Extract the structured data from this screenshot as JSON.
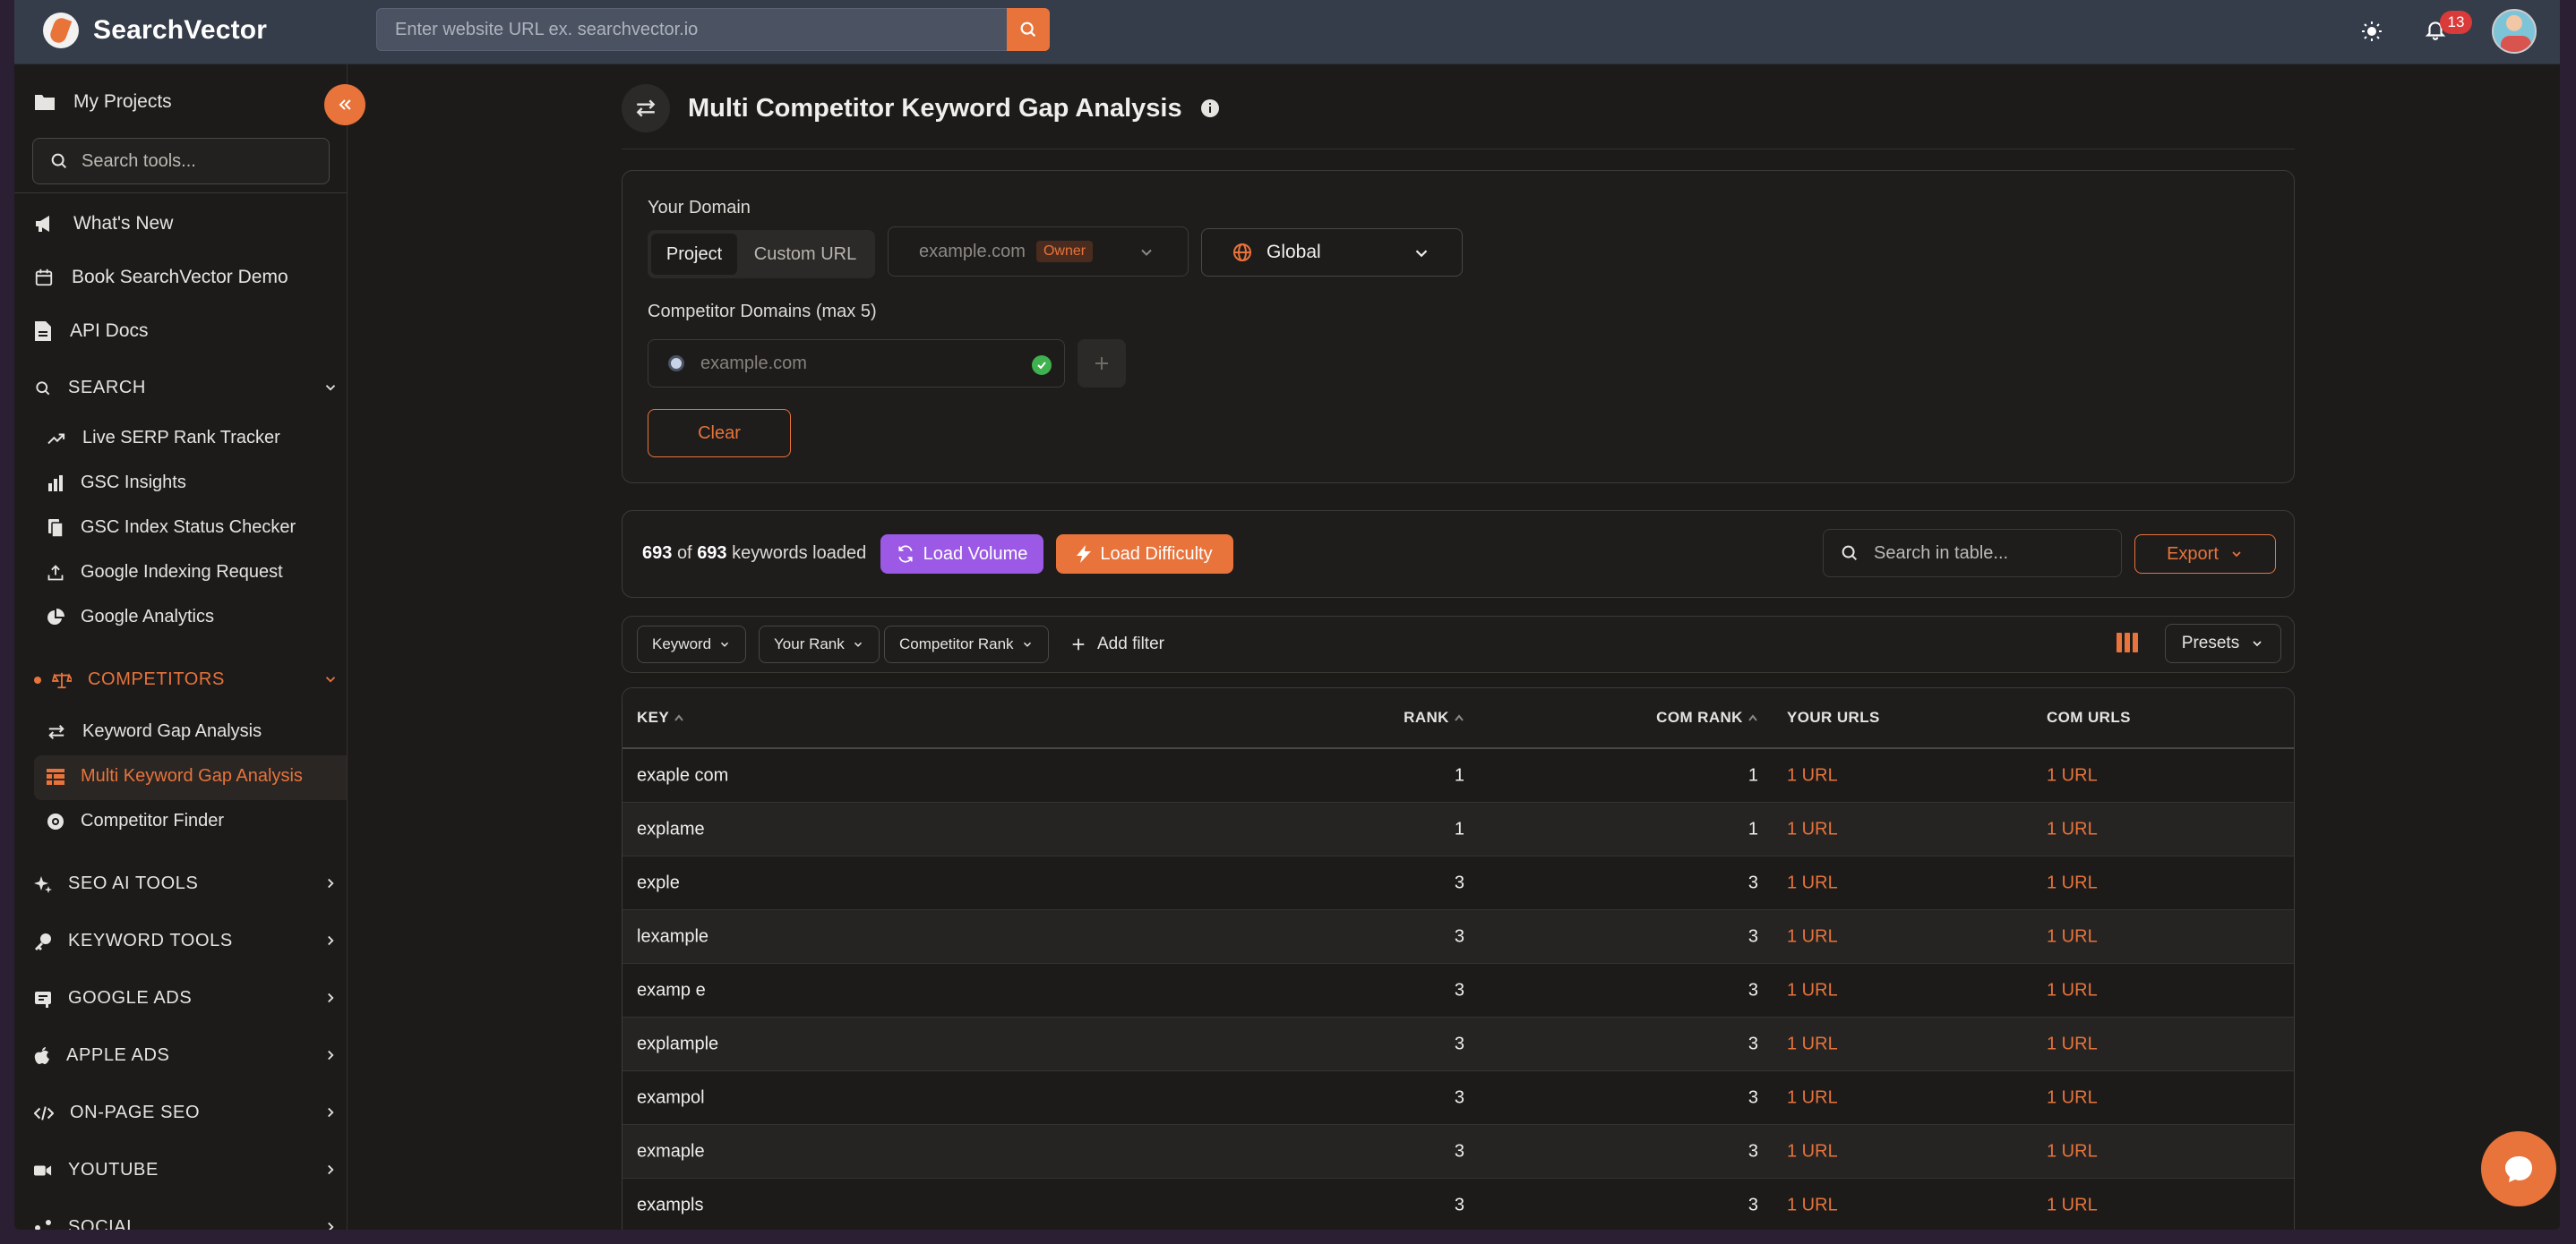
{
  "app": {
    "name": "SearchVector",
    "url_placeholder": "Enter website URL ex. searchvector.io",
    "notifications_count": "13",
    "colors": {
      "accent": "#e8733b",
      "purple": "#9b59e6",
      "topbar": "#353c4a",
      "background": "#1c1b1a"
    }
  },
  "sidebar": {
    "my_projects": "My Projects",
    "search_placeholder": "Search tools...",
    "links": [
      {
        "label": "What's New",
        "icon": "megaphone-icon"
      },
      {
        "label": "Book SearchVector Demo",
        "icon": "calendar-icon"
      },
      {
        "label": "API Docs",
        "icon": "document-icon"
      }
    ],
    "search_section": {
      "label": "SEARCH",
      "items": [
        {
          "label": "Live SERP Rank Tracker",
          "icon": "trend-icon"
        },
        {
          "label": "GSC Insights",
          "icon": "bar-chart-icon"
        },
        {
          "label": "GSC Index Status Checker",
          "icon": "index-icon"
        },
        {
          "label": "Google Indexing Request",
          "icon": "upload-icon"
        },
        {
          "label": "Google Analytics",
          "icon": "pie-chart-icon"
        }
      ]
    },
    "competitors_section": {
      "label": "COMPETITORS",
      "items": [
        {
          "label": "Keyword Gap Analysis",
          "icon": "swap-icon",
          "active": false
        },
        {
          "label": "Multi Keyword Gap Analysis",
          "icon": "table-icon",
          "active": true
        },
        {
          "label": "Competitor Finder",
          "icon": "radar-icon",
          "active": false
        }
      ]
    },
    "collapsed_sections": [
      {
        "label": "SEO AI TOOLS",
        "icon": "sparkle-icon"
      },
      {
        "label": "KEYWORD TOOLS",
        "icon": "key-icon"
      },
      {
        "label": "GOOGLE ADS",
        "icon": "ad-icon"
      },
      {
        "label": "APPLE ADS",
        "icon": "apple-icon"
      },
      {
        "label": "ON-PAGE SEO",
        "icon": "code-icon"
      },
      {
        "label": "YOUTUBE",
        "icon": "video-icon"
      },
      {
        "label": "SOCIAL",
        "icon": "share-icon"
      }
    ]
  },
  "page": {
    "title": "Multi Competitor Keyword Gap Analysis",
    "your_domain_label": "Your Domain",
    "domain_modes": [
      "Project",
      "Custom URL"
    ],
    "domain_value": "example.com",
    "owner_tag": "Owner",
    "region": "Global",
    "competitor_label": "Competitor Domains (max 5)",
    "competitor_placeholder": "example.com",
    "clear_label": "Clear"
  },
  "results": {
    "loaded": "693",
    "of_word": "of",
    "total": "693",
    "loaded_suffix": "keywords loaded",
    "load_volume": "Load Volume",
    "load_difficulty": "Load Difficulty",
    "search_placeholder": "Search in table...",
    "export": "Export",
    "filters": [
      "Keyword",
      "Your Rank",
      "Competitor Rank"
    ],
    "add_filter": "Add filter",
    "presets": "Presets"
  },
  "table": {
    "headers": {
      "key": "KEY",
      "rank": "RANK",
      "com_rank": "COM RANK",
      "your_urls": "YOUR URLS",
      "com_urls": "COM URLS"
    },
    "rows": [
      {
        "key": "exaple com",
        "rank": "1",
        "com_rank": "1",
        "your_urls": "1 URL",
        "com_urls": "1 URL"
      },
      {
        "key": "explame",
        "rank": "1",
        "com_rank": "1",
        "your_urls": "1 URL",
        "com_urls": "1 URL"
      },
      {
        "key": "exple",
        "rank": "3",
        "com_rank": "3",
        "your_urls": "1 URL",
        "com_urls": "1 URL"
      },
      {
        "key": "lexample",
        "rank": "3",
        "com_rank": "3",
        "your_urls": "1 URL",
        "com_urls": "1 URL"
      },
      {
        "key": "examp e",
        "rank": "3",
        "com_rank": "3",
        "your_urls": "1 URL",
        "com_urls": "1 URL"
      },
      {
        "key": "explample",
        "rank": "3",
        "com_rank": "3",
        "your_urls": "1 URL",
        "com_urls": "1 URL"
      },
      {
        "key": "exampol",
        "rank": "3",
        "com_rank": "3",
        "your_urls": "1 URL",
        "com_urls": "1 URL"
      },
      {
        "key": "exmaple",
        "rank": "3",
        "com_rank": "3",
        "your_urls": "1 URL",
        "com_urls": "1 URL"
      },
      {
        "key": "exampls",
        "rank": "3",
        "com_rank": "3",
        "your_urls": "1 URL",
        "com_urls": "1 URL"
      }
    ]
  }
}
